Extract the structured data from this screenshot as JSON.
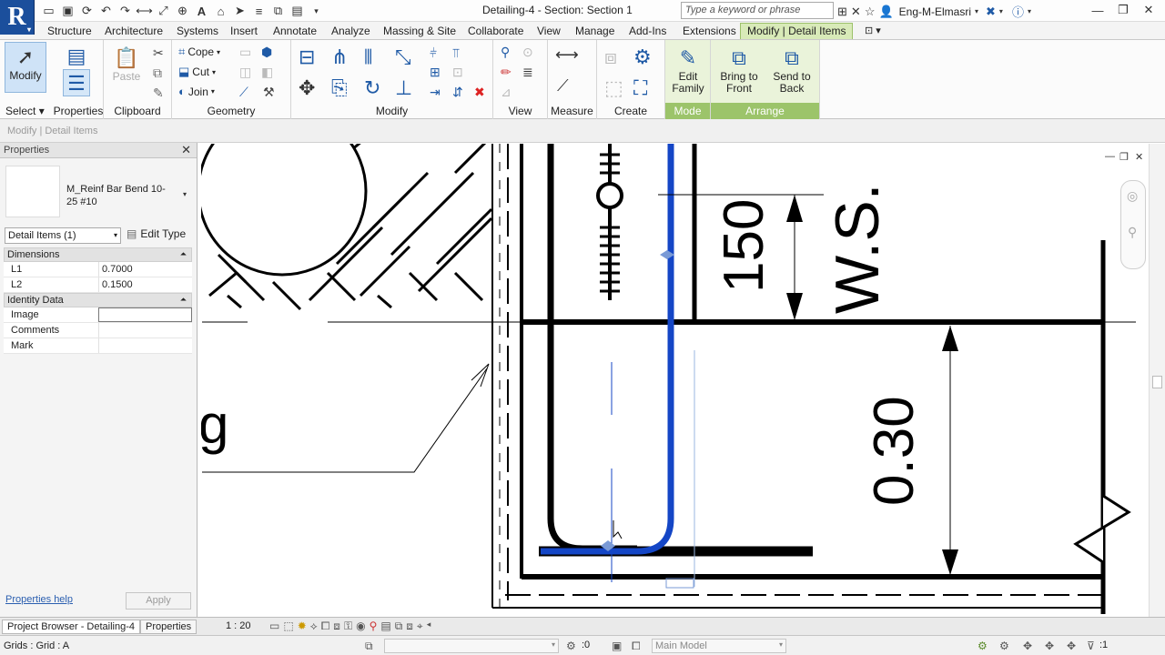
{
  "app": {
    "logo": "R",
    "title": "Detailing-4 - Section: Section 1",
    "search_placeholder": "Type a keyword or phrase",
    "user": "Eng-M-Elmasri"
  },
  "tabs": [
    "Structure",
    "Architecture",
    "Systems",
    "Insert",
    "Annotate",
    "Analyze",
    "Massing & Site",
    "Collaborate",
    "View",
    "Manage",
    "Add-Ins",
    "Extensions",
    "Modify | Detail Items"
  ],
  "ribbon": {
    "select": {
      "modify_label": "Modify",
      "panel": "Select",
      "properties_label": "Properties"
    },
    "clipboard": {
      "panel": "Clipboard",
      "paste_label": "Paste"
    },
    "geometry": {
      "panel": "Geometry",
      "cope": "Cope",
      "cut": "Cut",
      "join": "Join"
    },
    "modify_panel": "Modify",
    "view_panel": "View",
    "measure_panel": "Measure",
    "create_panel": "Create",
    "mode": {
      "panel": "Mode",
      "edit_family": "Edit Family"
    },
    "arrange": {
      "panel": "Arrange",
      "bring_to_front": "Bring to Front",
      "send_to_back": "Send to Back"
    }
  },
  "context_bar": "Modify | Detail Items",
  "properties": {
    "title": "Properties",
    "type_name": "M_Reinf Bar Bend 10-25 #10",
    "instance_selector": "Detail Items (1)",
    "edit_type": "Edit Type",
    "groups": {
      "dimensions": "Dimensions",
      "identity": "Identity Data"
    },
    "rows": {
      "l1_key": "L1",
      "l1_val": "0.7000",
      "l2_key": "L2",
      "l2_val": "0.1500",
      "image": "Image",
      "comments": "Comments",
      "mark": "Mark"
    },
    "help_link": "Properties help",
    "apply": "Apply"
  },
  "bottom": {
    "project_browser_tab": "Project Browser - Detailing-4",
    "properties_tab": "Properties",
    "scale": "1 : 20"
  },
  "status": {
    "text": "Grids : Grid : A",
    "selection_count": ":0",
    "model": "Main Model",
    "filter_count": ":1"
  },
  "drawing": {
    "dim_150": "150",
    "ws_label": "W.S.",
    "dim_030": "0.30",
    "partial_label": "g"
  },
  "colors": {
    "rebar_blue": "#1446c6",
    "ribbon_active": "#d8eab8"
  }
}
